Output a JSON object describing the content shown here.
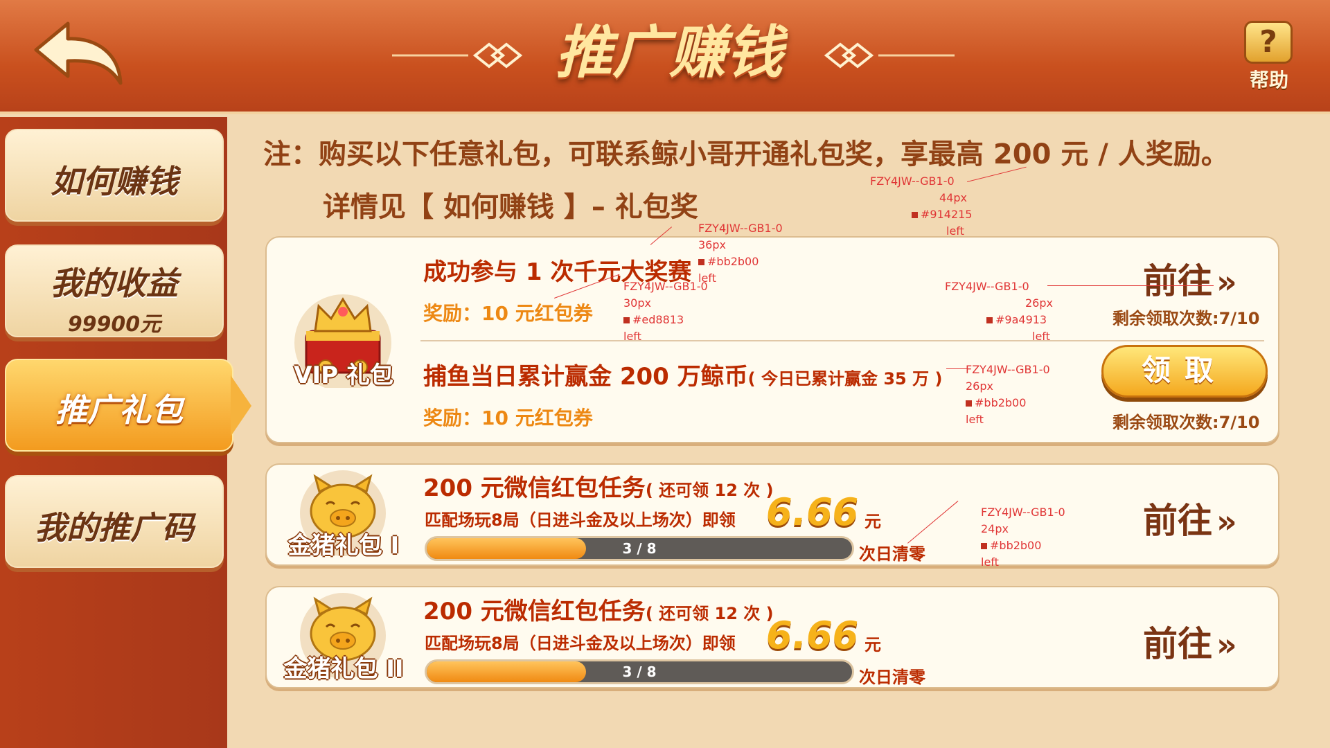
{
  "header": {
    "title": "推广赚钱",
    "help_label": "帮助"
  },
  "sidebar": {
    "items": [
      {
        "label": "如何赚钱"
      },
      {
        "label": "我的收益",
        "sub": "99900元"
      },
      {
        "label": "推广礼包"
      },
      {
        "label": "我的推广码"
      }
    ]
  },
  "note": {
    "line1": "注：购买以下任意礼包，可联系鲸小哥开通礼包奖，享最高 200 元 / 人奖励。",
    "line2": "详情见【 如何赚钱 】– 礼包奖"
  },
  "vip": {
    "icon_label": "VIP 礼包",
    "task1": {
      "title": "成功参与 1 次千元大奖赛",
      "reward": "奖励：10 元红包券",
      "go": "前往",
      "remaining": "剩余领取次数:7/10"
    },
    "task2": {
      "title": "捕鱼当日累计赢金 200 万鲸币",
      "detail": "( 今日已累计赢金 35 万 )",
      "reward": "奖励：10 元红包券",
      "claim": "领取",
      "remaining": "剩余领取次数:7/10"
    }
  },
  "pig1": {
    "icon_label": "金猪礼包 I",
    "title": "200 元微信红包任务",
    "title_note": "( 还可领 12 次 )",
    "task": "匹配场玩8局（日进斗金及以上场次）即领",
    "amount": "6.66",
    "unit": "元",
    "progress_text": "3 / 8",
    "progress": 0.375,
    "reset": "次日清零",
    "go": "前往"
  },
  "pig2": {
    "icon_label": "金猪礼包 II",
    "title": "200 元微信红包任务",
    "title_note": "( 还可领 12 次 )",
    "task": "匹配场玩8局（日进斗金及以上场次）即领",
    "amount": "6.66",
    "unit": "元",
    "progress_text": "3 / 8",
    "progress": 0.375,
    "reset": "次日清零",
    "go": "前往"
  },
  "annotations": [
    {
      "font": "FZY4JW--GB1-0",
      "size": "44px",
      "color": "#914215",
      "align": "left"
    },
    {
      "font": "FZY4JW--GB1-0",
      "size": "36px",
      "color": "#bb2b00",
      "align": "left"
    },
    {
      "font": "FZY4JW--GB1-0",
      "size": "30px",
      "color": "#ed8813",
      "align": "left"
    },
    {
      "font": "FZY4JW--GB1-0",
      "size": "26px",
      "color": "#9a4913",
      "align": "left"
    },
    {
      "font": "FZY4JW--GB1-0",
      "size": "26px",
      "color": "#bb2b00",
      "align": "left"
    },
    {
      "font": "FZY4JW--GB1-0",
      "size": "24px",
      "color": "#bb2b00",
      "align": "left"
    }
  ],
  "colors": {
    "header": "#c9501e",
    "sidebar": "#b8401a",
    "content_bg": "#f2d9b3",
    "accent": "#f39b1f"
  }
}
